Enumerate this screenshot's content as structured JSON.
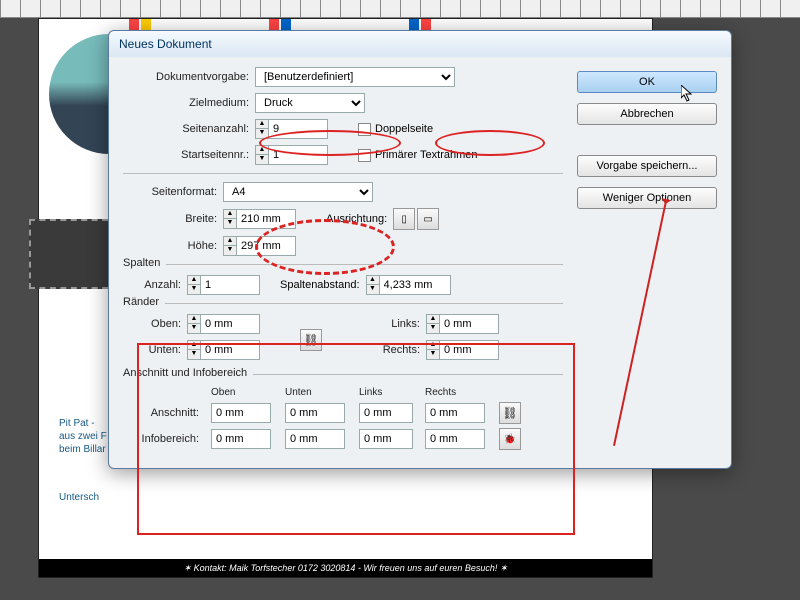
{
  "bg": {
    "text1": "Pit Pat -",
    "text2": "aus zwei F",
    "text3": "beim Billar",
    "text4": "Untersch",
    "footer": "✶ Kontakt: Maik Torfstecher 0172 3020814 - Wir freuen uns auf euren Besuch! ✶"
  },
  "dialog": {
    "title": "Neues Dokument",
    "preset_label": "Dokumentvorgabe:",
    "preset_value": "[Benutzerdefiniert]",
    "intent_label": "Zielmedium:",
    "intent_value": "Druck",
    "pages_label": "Seitenanzahl:",
    "pages_value": "9",
    "facing_label": "Doppelseite",
    "start_label": "Startseitennr.:",
    "start_value": "1",
    "primary_label": "Primärer Textrahmen",
    "size_label": "Seitenformat:",
    "size_value": "A4",
    "width_label": "Breite:",
    "width_value": "210 mm",
    "height_label": "Höhe:",
    "height_value": "297 mm",
    "orient_label": "Ausrichtung:",
    "columns_title": "Spalten",
    "col_count_label": "Anzahl:",
    "col_count_value": "1",
    "gutter_label": "Spaltenabstand:",
    "gutter_value": "4,233 mm",
    "margins_title": "Ränder",
    "top_label": "Oben:",
    "top_value": "0 mm",
    "bottom_label": "Unten:",
    "bottom_value": "0 mm",
    "left_label": "Links:",
    "left_value": "0 mm",
    "right_label": "Rechts:",
    "right_value": "0 mm",
    "bleed_title": "Anschnitt und Infobereich",
    "hd_top": "Oben",
    "hd_bottom": "Unten",
    "hd_left": "Links",
    "hd_right": "Rechts",
    "bleed_label": "Anschnitt:",
    "slug_label": "Infobereich:",
    "zero": "0 mm",
    "ok": "OK",
    "cancel": "Abbrechen",
    "save": "Vorgabe speichern...",
    "less": "Weniger Optionen"
  }
}
